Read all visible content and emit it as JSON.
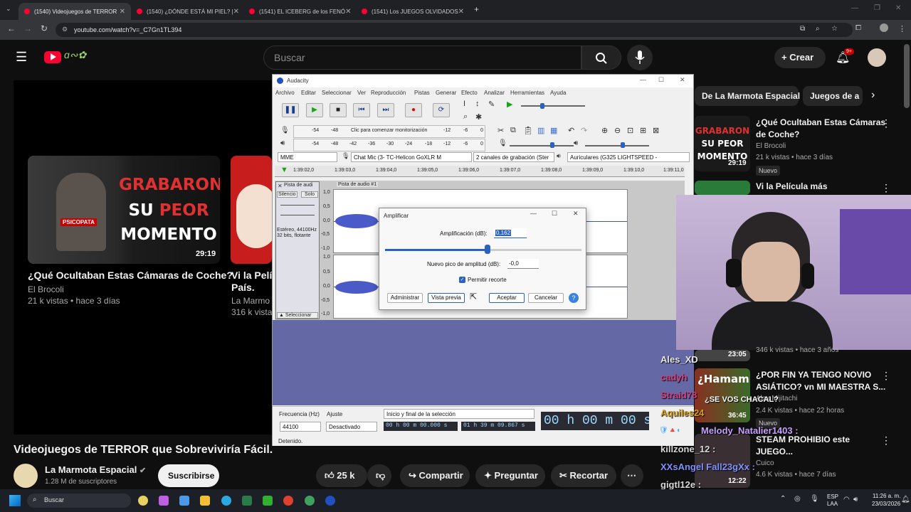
{
  "browser": {
    "tabs": [
      "(1540) Videojuegos de TERROR",
      "(1540) ¿DÓNDE ESTÁ MI PIEL? |",
      "(1541) EL ICEBERG de los FENÓ",
      "(1541) Los JUEGOS OLVIDADOS"
    ],
    "url": "youtube.com/watch?v=_C7Gn1TL394"
  },
  "youtube": {
    "search_placeholder": "Buscar",
    "create_label": "Crear",
    "notif_badge": "9+",
    "video_title": "Videojuegos de TERROR que Sobreviviría Fácil.",
    "channel_name": "La Marmota Espacial",
    "subscribers": "1.28 M de suscriptores",
    "subscribe_label": "Suscribirse",
    "likes": "25 k",
    "share_label": "Compartir",
    "ask_label": "Preguntar",
    "clip_label": "Recortar",
    "chips": [
      "De La Marmota Espacial",
      "Juegos de a"
    ]
  },
  "endscreen": {
    "card1": {
      "thumb_line1": "GRABARON",
      "thumb_line2a": "SU",
      "thumb_line2b": "PEOR",
      "thumb_line3": "MOMENTO",
      "thumb_tag": "PSICOPATA",
      "duration": "29:19",
      "title": "¿Qué Ocultaban Estas Cámaras de Coche?",
      "channel": "El Brocoli",
      "meta": "21 k vistas • hace 3 días"
    },
    "card2": {
      "title_line1": "Vi la Pelíc",
      "title_line2": "País.",
      "channel": "La Marmo",
      "meta": "316 k vista"
    }
  },
  "audacity": {
    "window_title": "Audacity",
    "menus": [
      "Archivo",
      "Editar",
      "Seleccionar",
      "Ver",
      "Reproducción",
      "Pistas",
      "Generar",
      "Efecto",
      "Analizar",
      "Herramientas",
      "Ayuda"
    ],
    "meter_rec_ticks": [
      "-54",
      "-48",
      "Clic para comenzar monitorización",
      "-12",
      "-6",
      "0"
    ],
    "meter_play_ticks": [
      "-54",
      "-48",
      "-42",
      "-36",
      "-30",
      "-24",
      "-18",
      "-12",
      "-6",
      "0"
    ],
    "host": "MME",
    "input_device": "Chat Mic (3- TC-Helicon GoXLR M",
    "channels": "2 canales de grabación (Ster",
    "output_device": "Auriculares (G325 LIGHTSPEED -",
    "timeline": [
      "1:39:02,0",
      "1:39:03,0",
      "1:39:04,0",
      "1:39:05,0",
      "1:39:06,0",
      "1:39:07,0",
      "1:39:08,0",
      "1:39:09,0",
      "1:39:10,0",
      "1:39:11,0"
    ],
    "track_name": "Pista de audi",
    "track_title": "Pista de audio #1",
    "mute": "Silencio",
    "solo": "Solo",
    "track_info1": "Estéreo, 44100Hz",
    "track_info2": "32 bits, flotante",
    "select_btn": "Seleccionar",
    "scale": [
      "1,0",
      "0,5",
      "0,0",
      "-0,5",
      "-1,0",
      "1,0",
      "0,5",
      "0,0",
      "-0,5",
      "-1,0"
    ],
    "rate_label": "Frecuencia (Hz)",
    "rate_value": "44100",
    "snap_label": "Ajuste",
    "snap_value": "Desactivado",
    "sel_label": "Inicio y final de la selección",
    "sel_start": "00 h 00 m 00.000 s",
    "sel_end": "01 h 39 m 09.867 s",
    "big_time": "00 h 00 m 00 s",
    "status": "Detenido."
  },
  "dialog": {
    "title": "Amplificar",
    "amp_label": "Amplificación (dB):",
    "amp_value": "0,162",
    "peak_label": "Nuevo pico de amplitud (dB):",
    "peak_value": "-0,0",
    "allow_clip": "Permitir recorte",
    "manage": "Administrar",
    "preview": "Vista previa",
    "ok": "Aceptar",
    "cancel": "Cancelar",
    "amp_fraction": 0.52
  },
  "sidebar": {
    "v1": {
      "thumb_line1": "GRABARON",
      "thumb_line2": "SU PEOR",
      "thumb_line3": "MOMENTO",
      "duration": "29:19",
      "title_line1": "¿Qué Ocultaban Estas Cámaras",
      "title_line2": "de Coche?",
      "channel": "El Brocoli",
      "meta": "21 k vistas • hace 3 días",
      "badge": "Nuevo"
    },
    "v2": {
      "title": "Vi la Película más"
    },
    "v3": {
      "duration": "23:05",
      "meta": "346 k vistas • hace 3 años"
    },
    "v4": {
      "thumb": "¿Hamam",
      "duration": "36:45",
      "title_line1": "¿POR FIN YA TENGO NOVIO",
      "title_line2": "ASIÁTICO? vn MI MAESTRA S...",
      "channel": "Alex Mijitachi",
      "meta": "2.4 K vistas • hace 22 horas",
      "badge": "Nuevo"
    },
    "v5": {
      "duration": "12:22",
      "title_line1": "STEAM PROHIBIO este",
      "title_line2": "JUEGO...",
      "channel": "Cuico",
      "meta": "4.6 K vistas • hace 7 días"
    }
  },
  "chat": [
    {
      "name": "Ales_XD",
      "color": "#e8e8e8"
    },
    {
      "name": "cadyh",
      "color": "#d04080"
    },
    {
      "name": "Straid78",
      "color": "#d04080"
    },
    {
      "name": "¿SE VOS CHACAL?",
      "color": "#ffffff"
    },
    {
      "name": "Aquiles24",
      "color": "#d4a020"
    },
    {
      "name": "Melody_Natalier1403 :",
      "color": "#c8a0ff"
    },
    {
      "name": "killzone_12 :",
      "color": "#d8d8d8"
    },
    {
      "name": "XXsAngel Fall23gXx :",
      "color": "#8090ff"
    },
    {
      "name": "gigtl12e :",
      "color": "#d8d8d8"
    }
  ],
  "taskbar": {
    "search": "Buscar",
    "lang1": "ESP",
    "lang2": "LAA",
    "time": "11:26 a. m.",
    "date": "23/03/2026"
  }
}
